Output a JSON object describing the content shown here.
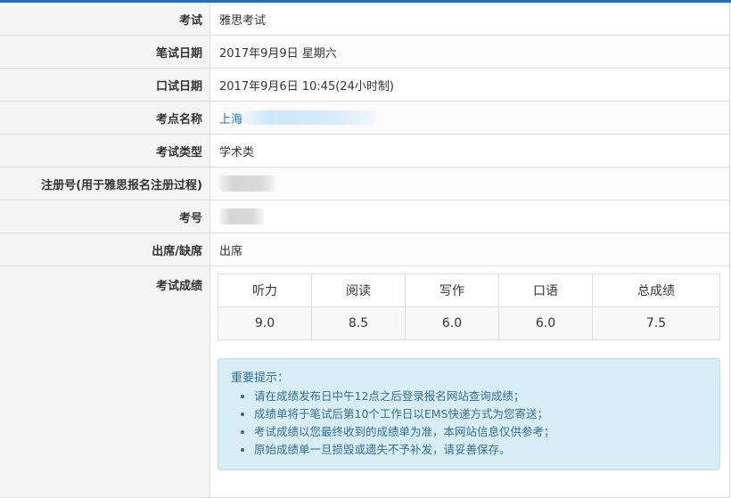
{
  "rows": [
    {
      "label": "考试",
      "value": "雅思考试"
    },
    {
      "label": "笔试日期",
      "value": "2017年9月9日 星期六"
    },
    {
      "label": "口试日期",
      "value": "2017年9月6日 10:45(24小时制)"
    },
    {
      "label": "考点名称",
      "value": "上海"
    },
    {
      "label": "考试类型",
      "value": "学术类"
    },
    {
      "label": "注册号(用于雅思报名注册过程)",
      "value": ""
    },
    {
      "label": "考号",
      "value": ""
    },
    {
      "label": "出席/缺席",
      "value": "出席"
    },
    {
      "label": "考试成绩",
      "value": ""
    }
  ],
  "scores": {
    "headers": [
      "听力",
      "阅读",
      "写作",
      "口语",
      "总成绩"
    ],
    "values": [
      "9.0",
      "8.5",
      "6.0",
      "6.0",
      "7.5"
    ]
  },
  "notice": {
    "title": "重要提示：",
    "items": [
      "请在成绩发布日中午12点之后登录报名网站查询成绩；",
      "成绩单将于笔试后第10个工作日以EMS快递方式为您寄送；",
      "考试成绩以您最终收到的成绩单为准，本网站信息仅供参考；",
      "原始成绩单一旦损毁或遗失不予补发，请妥善保存。"
    ]
  },
  "colors": {
    "accent": "#2a6ebb",
    "link": "#1f6fc5",
    "notice_bg": "#d9edf7",
    "notice_text": "#31708f"
  }
}
